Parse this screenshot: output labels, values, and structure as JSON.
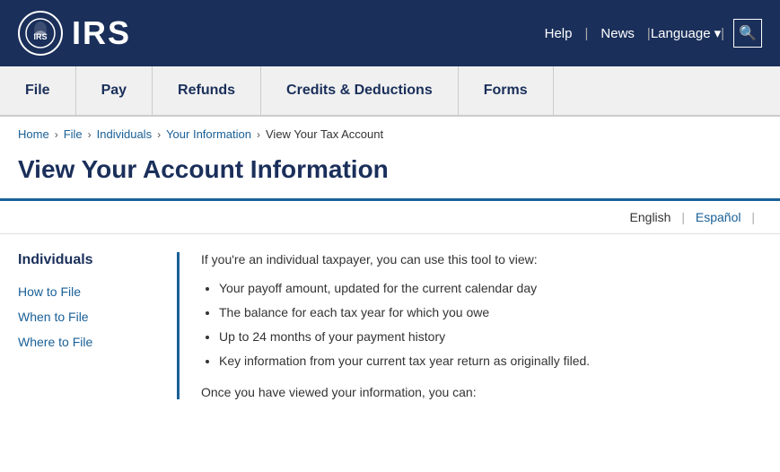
{
  "header": {
    "logo_text": "IRS",
    "nav": {
      "help_label": "Help",
      "news_label": "News",
      "language_label": "Language",
      "language_arrow": "▾"
    }
  },
  "nav_bar": {
    "items": [
      {
        "label": "File"
      },
      {
        "label": "Pay"
      },
      {
        "label": "Refunds"
      },
      {
        "label": "Credits & Deductions"
      },
      {
        "label": "Forms"
      }
    ]
  },
  "breadcrumb": {
    "items": [
      {
        "label": "Home",
        "link": true
      },
      {
        "label": "File",
        "link": true
      },
      {
        "label": "Individuals",
        "link": true
      },
      {
        "label": "Your Information",
        "link": true
      },
      {
        "label": "View Your Tax Account",
        "link": false
      }
    ]
  },
  "page_title": "View Your Account Information",
  "language_selector": {
    "active": "English",
    "other": "Español"
  },
  "sidebar": {
    "title": "Individuals",
    "links": [
      "How to File",
      "When to File",
      "Where to File"
    ]
  },
  "content": {
    "intro": "If you're an individual taxpayer, you can use this tool to view:",
    "bullet_points": [
      "Your payoff amount, updated for the current calendar day",
      "The balance for each tax year for which you owe",
      "Up to 24 months of your payment history",
      "Key information from your current tax year return as originally filed."
    ],
    "once_text": "Once you have viewed your information, you can:"
  }
}
